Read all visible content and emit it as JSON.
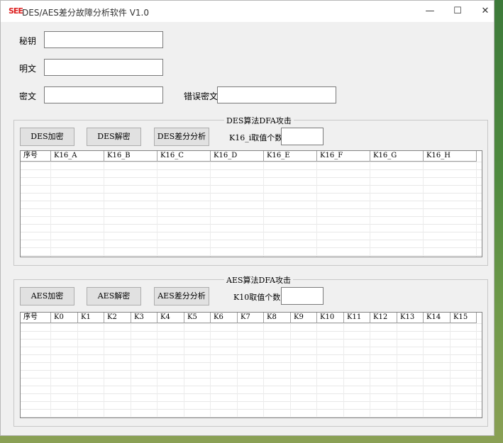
{
  "window": {
    "icon_text": "SEE",
    "title": "DES/AES差分故障分析软件 V1.0",
    "controls": {
      "minimize": "—",
      "maximize": "☐",
      "close": "✕"
    }
  },
  "form": {
    "key_label": "秘钥",
    "key_value": "",
    "plaintext_label": "明文",
    "plaintext_value": "",
    "ciphertext_label": "密文",
    "ciphertext_value": "",
    "faulty_ciphertext_label": "错误密文",
    "faulty_ciphertext_value": ""
  },
  "des": {
    "group_title": "DES算法DFA攻击",
    "encrypt_label": "DES加密",
    "decrypt_label": "DES解密",
    "analyze_label": "DES差分分析",
    "count_label": "K16_i取值个数",
    "count_value": "",
    "columns": [
      "序号",
      "K16_A",
      "K16_B",
      "K16_C",
      "K16_D",
      "K16_E",
      "K16_F",
      "K16_G",
      "K16_H"
    ]
  },
  "aes": {
    "group_title": "AES算法DFA攻击",
    "encrypt_label": "AES加密",
    "decrypt_label": "AES解密",
    "analyze_label": "AES差分分析",
    "count_label": "K10取值个数",
    "count_value": "",
    "columns": [
      "序号",
      "K0",
      "K1",
      "K2",
      "K3",
      "K4",
      "K5",
      "K6",
      "K7",
      "K8",
      "K9",
      "K10",
      "K11",
      "K12",
      "K13",
      "K14",
      "K15"
    ]
  }
}
